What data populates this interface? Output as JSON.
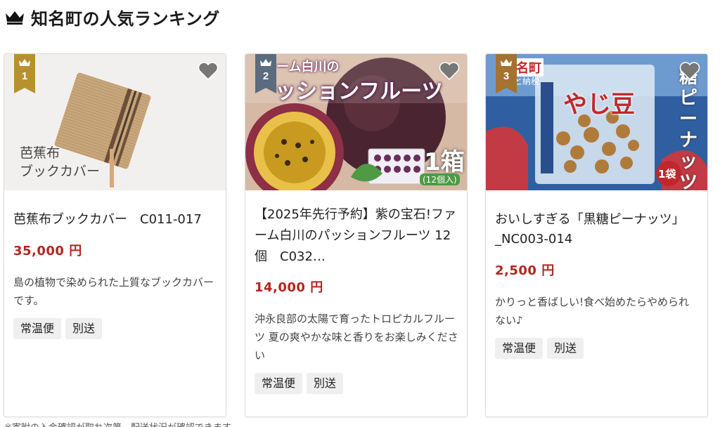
{
  "section": {
    "title": "知名町の人気ランキング"
  },
  "colors": {
    "gold": "#b8912e",
    "slate": "#5b6b80",
    "bronze": "#a5722f",
    "price": "#b0271f"
  },
  "cards": [
    {
      "rank": "1",
      "image_text": "芭蕉布\nブックカバー",
      "title": "芭蕉布ブックカバー　C011-017",
      "price": "35,000 円",
      "description": "島の植物で染められた上質なブックカバーです。",
      "tags": [
        "常温便",
        "別送"
      ]
    },
    {
      "rank": "2",
      "image_text_top": "ーム白川の",
      "image_text_main": "ッションフルーツ",
      "image_text_box": "1箱",
      "image_text_box_sub": "(12個入)",
      "title": "【2025年先行予約】紫の宝石!ファーム白川のパッションフルーツ 12個　C032…",
      "price": "14,000 円",
      "description": "沖永良部の太陽で育ったトロピカルフルーツ 夏の爽やかな味と香りをお楽しみください",
      "tags": [
        "常温便",
        "別送"
      ]
    },
    {
      "rank": "3",
      "image_text_corner": "名町",
      "image_text_corner_sub": "と納税",
      "image_text_vertical": "糖ピーナッツ",
      "image_text_bag": "やじ豆",
      "image_text_count": "1袋",
      "title": "おいしすぎる「黒糖ピーナッツ」_NC003-014",
      "price": "2,500 円",
      "description": "かりっと香ばしい!食べ始めたらやめられない♪",
      "tags": [
        "常温便",
        "別送"
      ]
    }
  ],
  "footer_note": "※寄附の入金確認が取れ次第、配送状況が確認できます。"
}
